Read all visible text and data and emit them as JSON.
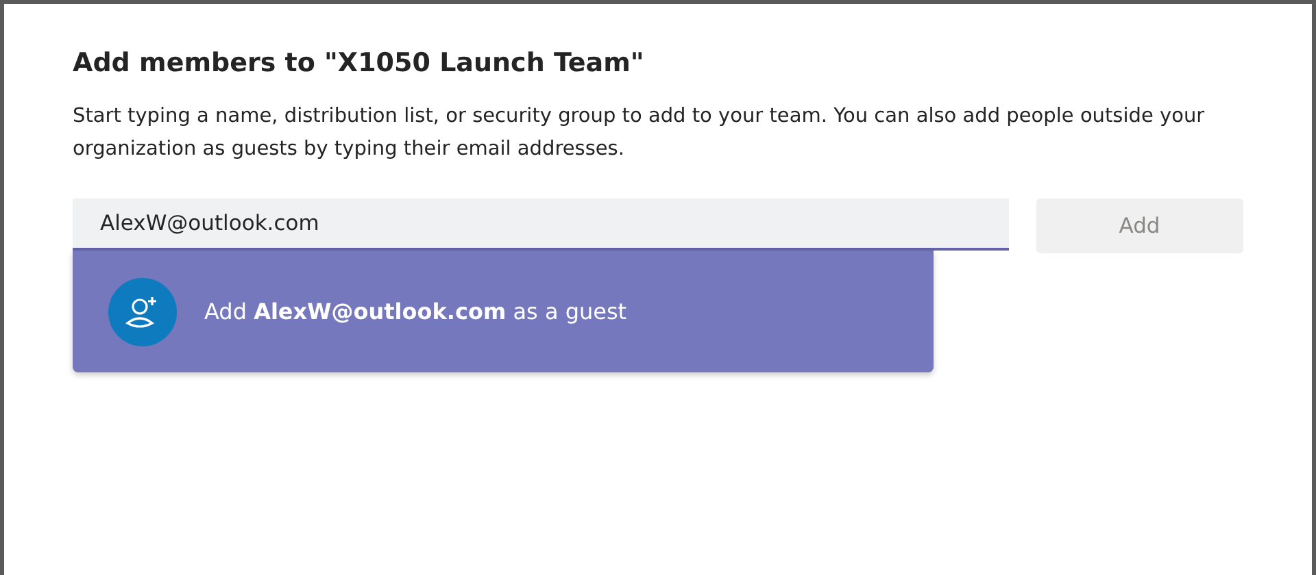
{
  "dialog": {
    "title": "Add members to \"X1050 Launch Team\"",
    "description": "Start typing a name, distribution list, or security group to add to your team. You can also add people outside your organization as guests by typing their email addresses.",
    "search": {
      "value": "AlexW@outlook.com"
    },
    "add_button": {
      "label": "Add",
      "disabled": true
    },
    "suggestion": {
      "text": "Add **AlexW@outlook.com** as a guest",
      "selected": true
    }
  }
}
